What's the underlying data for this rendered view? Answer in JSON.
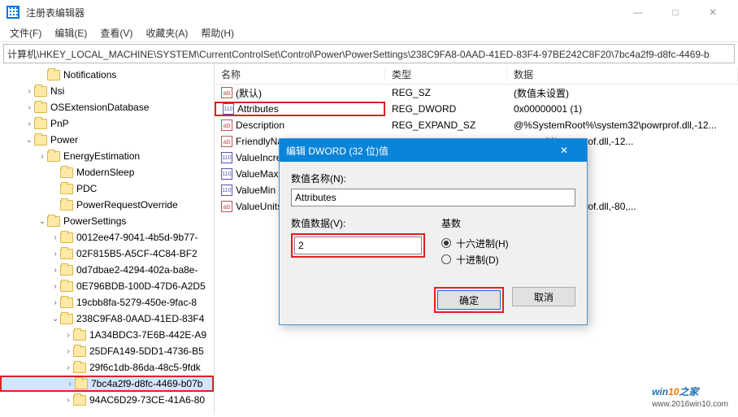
{
  "window": {
    "title": "注册表编辑器",
    "minimize": "—",
    "maximize": "□",
    "close": "✕"
  },
  "menu": {
    "file": "文件(F)",
    "edit": "编辑(E)",
    "view": "查看(V)",
    "favorites": "收藏夹(A)",
    "help": "帮助(H)"
  },
  "address": {
    "path": "计算机\\HKEY_LOCAL_MACHINE\\SYSTEM\\CurrentControlSet\\Control\\Power\\PowerSettings\\238C9FA8-0AAD-41ED-83F4-97BE242C8F20\\7bc4a2f9-d8fc-4469-b"
  },
  "tree": [
    {
      "indent": 46,
      "chev": "",
      "label": "Notifications"
    },
    {
      "indent": 30,
      "chev": "›",
      "label": "Nsi"
    },
    {
      "indent": 30,
      "chev": "›",
      "label": "OSExtensionDatabase"
    },
    {
      "indent": 30,
      "chev": "›",
      "label": "PnP"
    },
    {
      "indent": 30,
      "chev": "⌄",
      "label": "Power"
    },
    {
      "indent": 46,
      "chev": "›",
      "label": "EnergyEstimation"
    },
    {
      "indent": 62,
      "chev": "",
      "label": "ModernSleep"
    },
    {
      "indent": 62,
      "chev": "",
      "label": "PDC"
    },
    {
      "indent": 62,
      "chev": "",
      "label": "PowerRequestOverride"
    },
    {
      "indent": 46,
      "chev": "⌄",
      "label": "PowerSettings"
    },
    {
      "indent": 62,
      "chev": "›",
      "label": "0012ee47-9041-4b5d-9b77-"
    },
    {
      "indent": 62,
      "chev": "›",
      "label": "02F815B5-A5CF-4C84-BF2"
    },
    {
      "indent": 62,
      "chev": "›",
      "label": "0d7dbae2-4294-402a-ba8e-"
    },
    {
      "indent": 62,
      "chev": "›",
      "label": "0E796BDB-100D-47D6-A2D5"
    },
    {
      "indent": 62,
      "chev": "›",
      "label": "19cbb8fa-5279-450e-9fac-8"
    },
    {
      "indent": 62,
      "chev": "⌄",
      "label": "238C9FA8-0AAD-41ED-83F4"
    },
    {
      "indent": 78,
      "chev": "›",
      "label": "1A34BDC3-7E6B-442E-A9"
    },
    {
      "indent": 78,
      "chev": "›",
      "label": "25DFA149-5DD1-4736-B5"
    },
    {
      "indent": 78,
      "chev": "›",
      "label": "29f6c1db-86da-48c5-9fdk"
    },
    {
      "indent": 78,
      "chev": "›",
      "label": "7bc4a2f9-d8fc-4469-b07b",
      "selected": true,
      "highlight": true
    },
    {
      "indent": 78,
      "chev": "›",
      "label": "94AC6D29-73CE-41A6-80"
    }
  ],
  "list": {
    "headers": {
      "name": "名称",
      "type": "类型",
      "data": "数据"
    },
    "rows": [
      {
        "icon": "str",
        "name": "(默认)",
        "type": "REG_SZ",
        "data": "(数值未设置)"
      },
      {
        "icon": "bin",
        "name": "Attributes",
        "type": "REG_DWORD",
        "data": "0x00000001 (1)",
        "highlight": true
      },
      {
        "icon": "str",
        "name": "Description",
        "type": "REG_EXPAND_SZ",
        "data": "@%SystemRoot%\\system32\\powrprof.dll,-12..."
      },
      {
        "icon": "str",
        "name": "FriendlyName",
        "type_partial": "",
        "data_partial": "system32\\powrprof.dll,-12..."
      },
      {
        "icon": "bin",
        "name": "ValueIncrement"
      },
      {
        "icon": "bin",
        "name": "ValueMax"
      },
      {
        "icon": "bin",
        "name": "ValueMin"
      },
      {
        "icon": "str",
        "name": "ValueUnits",
        "data_partial": "system32\\powrprof.dll,-80,..."
      }
    ]
  },
  "dialog": {
    "title": "编辑 DWORD (32 位)值",
    "close": "✕",
    "name_label": "数值名称(N):",
    "name_value": "Attributes",
    "data_label": "数值数据(V):",
    "data_value": "2",
    "base_label": "基数",
    "radio_hex": "十六进制(H)",
    "radio_dec": "十进制(D)",
    "ok": "确定",
    "cancel": "取消"
  },
  "watermark": {
    "brand_a": "win",
    "brand_b": "10",
    "brand_c": "之家",
    "url": "www.2016win10.com"
  }
}
